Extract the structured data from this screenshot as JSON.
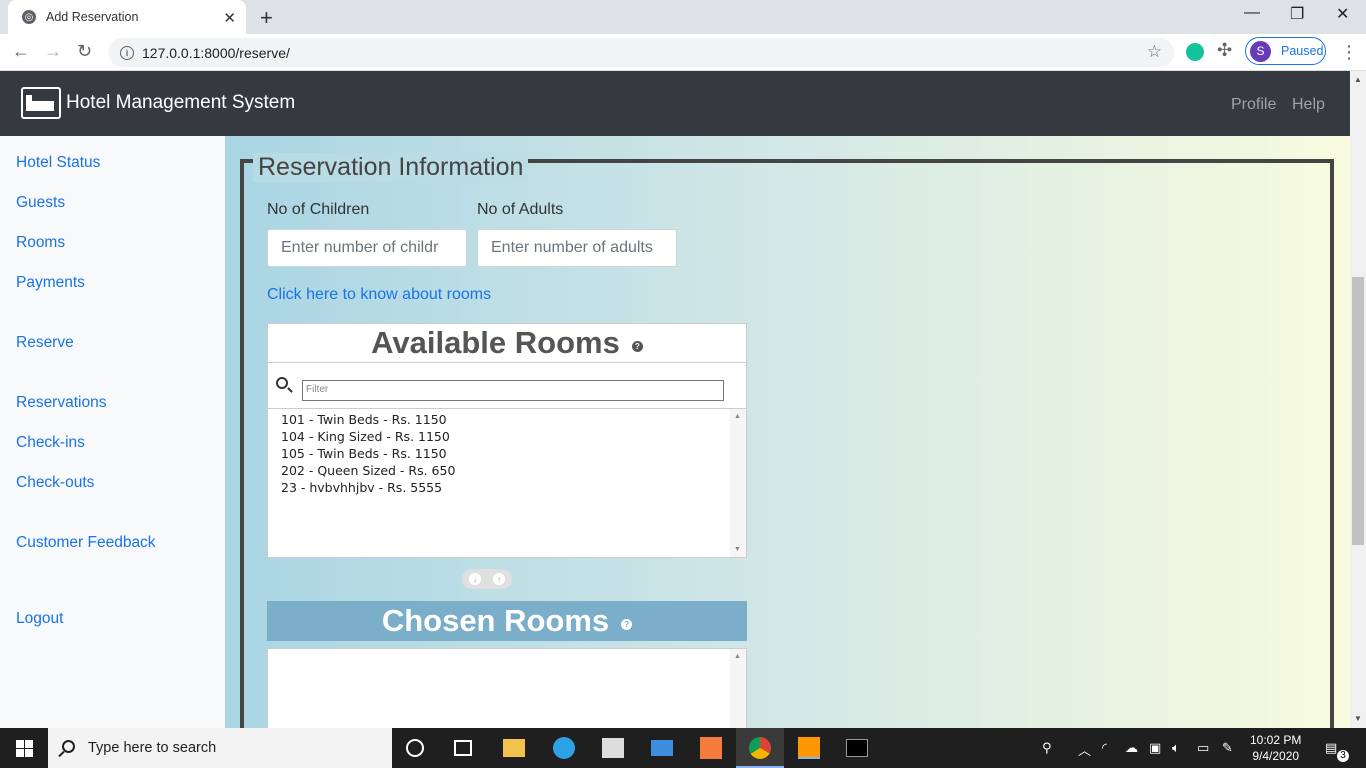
{
  "browser": {
    "tab_title": "Add Reservation",
    "url": "127.0.0.1:8000/reserve/",
    "profile_initial": "S",
    "profile_status": "Paused"
  },
  "app": {
    "brand": "Hotel Management System",
    "nav": {
      "profile": "Profile",
      "help": "Help"
    }
  },
  "sidebar": {
    "items": [
      {
        "label": "Hotel Status"
      },
      {
        "label": "Guests"
      },
      {
        "label": "Rooms"
      },
      {
        "label": "Payments"
      },
      {
        "label": "Reserve"
      },
      {
        "label": "Reservations"
      },
      {
        "label": "Check-ins"
      },
      {
        "label": "Check-outs"
      },
      {
        "label": "Customer Feedback"
      },
      {
        "label": "Logout"
      }
    ]
  },
  "form": {
    "legend": "Reservation Information",
    "children_label": "No of Children",
    "children_placeholder": "Enter number of childr",
    "adults_label": "No of Adults",
    "adults_placeholder": "Enter number of adults",
    "rooms_link": "Click here to know about rooms",
    "available_title": "Available Rooms",
    "filter_placeholder": "Filter",
    "available_rooms": [
      "101 - Twin Beds - Rs. 1150",
      "104 - King Sized - Rs. 1150",
      "105 - Twin Beds - Rs. 1150",
      "202 - Queen Sized - Rs. 650",
      "23 - hvbvhhjbv - Rs. 5555"
    ],
    "chosen_title": "Chosen Rooms"
  },
  "taskbar": {
    "search_placeholder": "Type here to search",
    "time": "10:02 PM",
    "date": "9/4/2020",
    "notifications": "3"
  }
}
